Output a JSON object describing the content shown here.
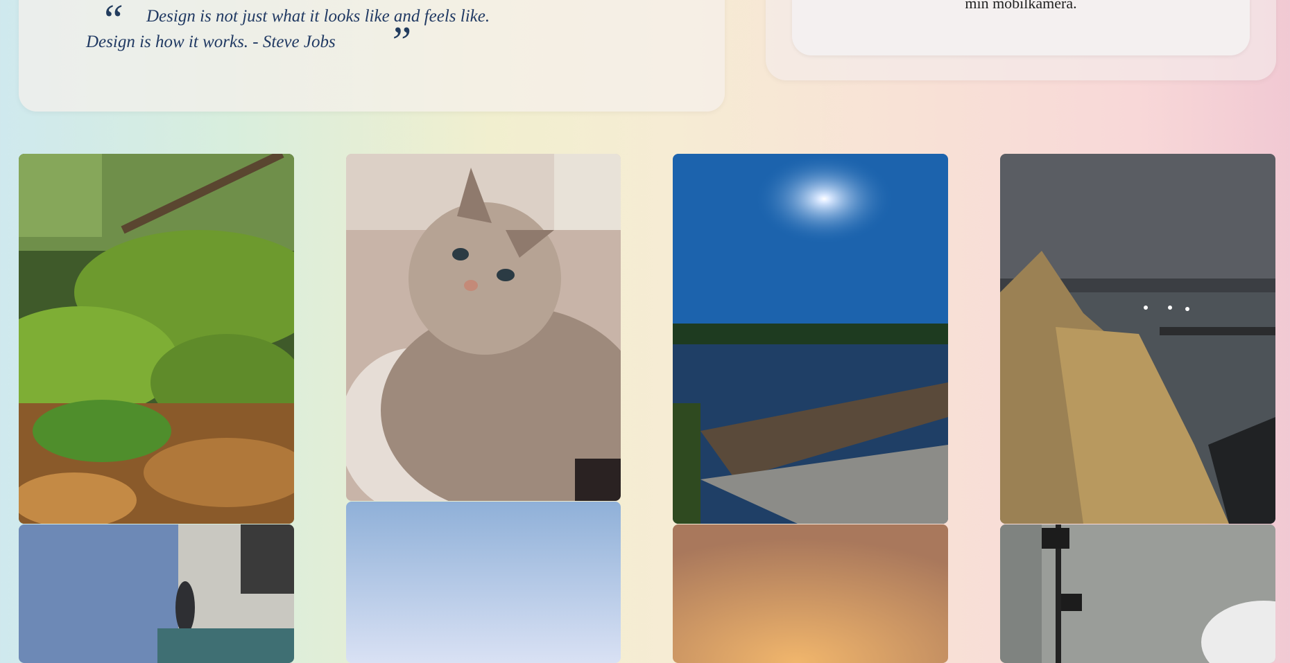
{
  "quote": {
    "open_mark": "“",
    "close_mark": "”",
    "line1": "Design is not just what it looks like and feels like.",
    "line2": "Design is how it works. - Steve Jobs"
  },
  "intro_card": {
    "text": "min mobilkamera."
  },
  "gallery": {
    "photos": [
      {
        "subject": "moss-forest"
      },
      {
        "subject": "fluffy-cat"
      },
      {
        "subject": "lake-pier-sun"
      },
      {
        "subject": "night-reeds-lake"
      },
      {
        "subject": "statue-sky"
      },
      {
        "subject": "pale-sky"
      },
      {
        "subject": "orange-sunset"
      },
      {
        "subject": "grey-room"
      }
    ]
  },
  "colors": {
    "quote_text": "#213a63",
    "card_bg": "#f5f0ec"
  }
}
